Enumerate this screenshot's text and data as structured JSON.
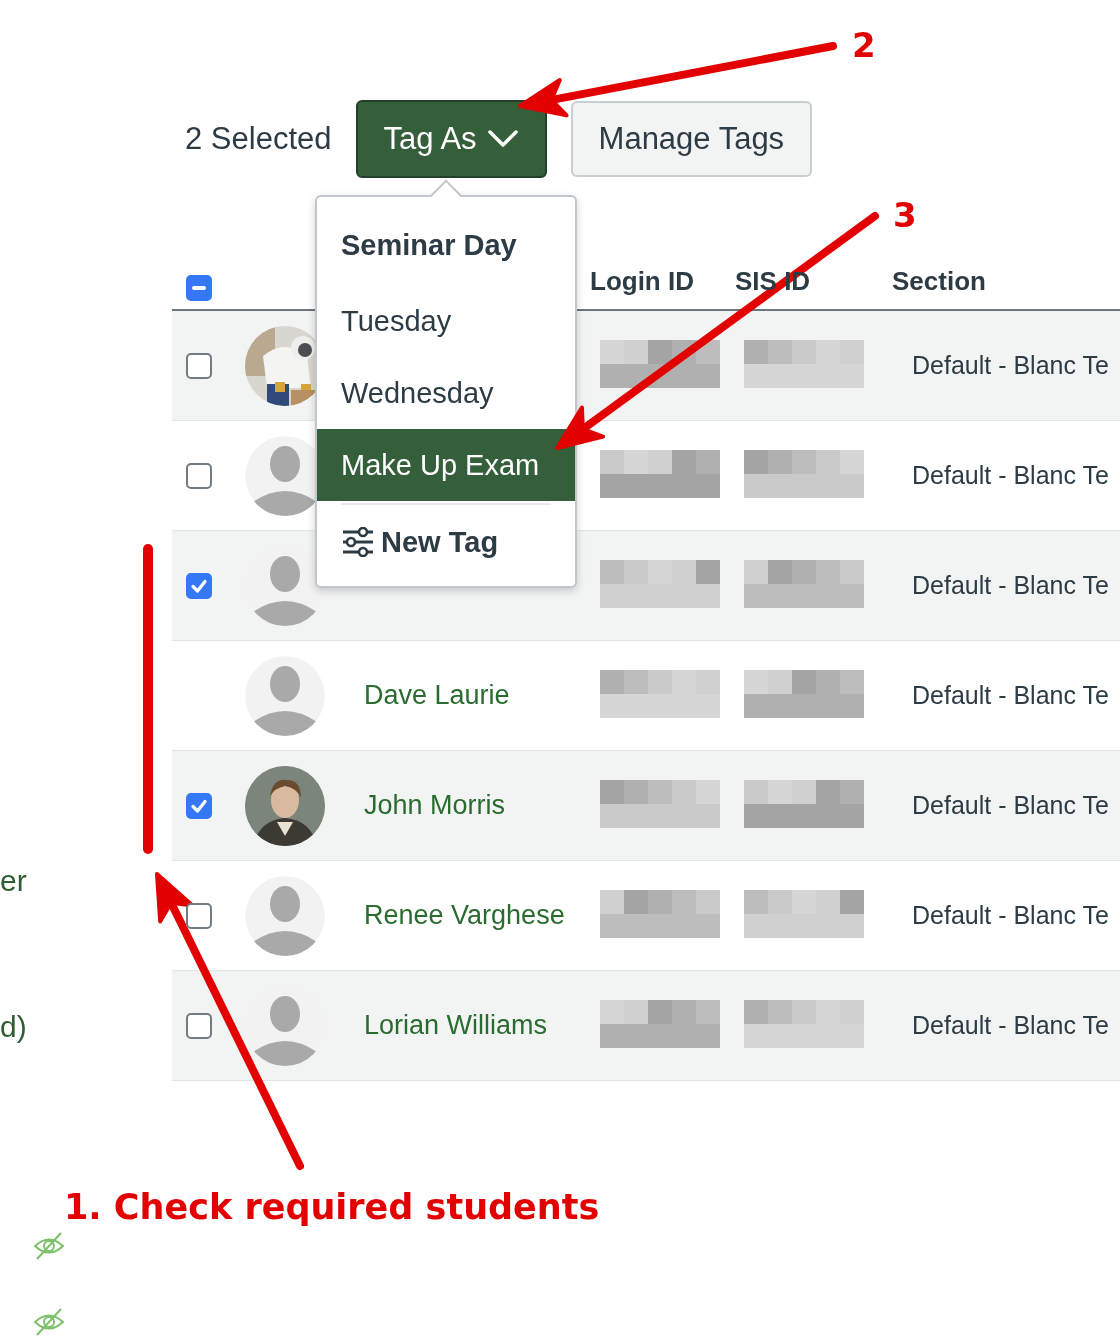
{
  "toolbar": {
    "selected_count": "2 Selected",
    "buttons": [
      {
        "label": "Tag As",
        "kind": "primary",
        "expanded": true
      },
      {
        "label": "Manage Tags",
        "kind": "secondary"
      }
    ]
  },
  "tag_menu": {
    "items": [
      {
        "label": "Seminar Day",
        "kind": "heading"
      },
      {
        "label": "Tuesday",
        "kind": "option",
        "selected": false
      },
      {
        "label": "Wednesday",
        "kind": "option",
        "selected": false
      },
      {
        "label": "Make Up Exam",
        "kind": "option",
        "selected": true
      },
      {
        "label": "New Tag",
        "kind": "action"
      }
    ]
  },
  "table": {
    "select_all": {
      "indeterminate": true
    },
    "columns": [
      "Login ID",
      "SIS ID",
      "Section"
    ],
    "rows": [
      {
        "checked": false,
        "section": "Default - Blanc Te"
      },
      {
        "avatar": {
          "kind": "default"
        },
        "checked": false,
        "section": "Default - Blanc Te"
      },
      {
        "avatar": {
          "kind": "default"
        },
        "checked": true,
        "section": "Default - Blanc Te"
      },
      {
        "name": "Dave Laurie",
        "avatar": {
          "kind": "default"
        },
        "section": "Default - Blanc Te"
      },
      {
        "name": "John Morris",
        "checked": true,
        "section": "Default - Blanc Te"
      },
      {
        "name": "Renee Varghese",
        "avatar": {
          "kind": "default"
        },
        "checked": false,
        "section": "Default - Blanc Te"
      },
      {
        "name": "Lorian Williams",
        "avatar": {
          "kind": "default"
        },
        "checked": false,
        "section": "Default - Blanc Te"
      }
    ]
  },
  "side_fragments": [
    "er",
    "d)"
  ],
  "annotations": {
    "markers": [
      "2",
      "3"
    ],
    "caption": "1. Check required students"
  }
}
